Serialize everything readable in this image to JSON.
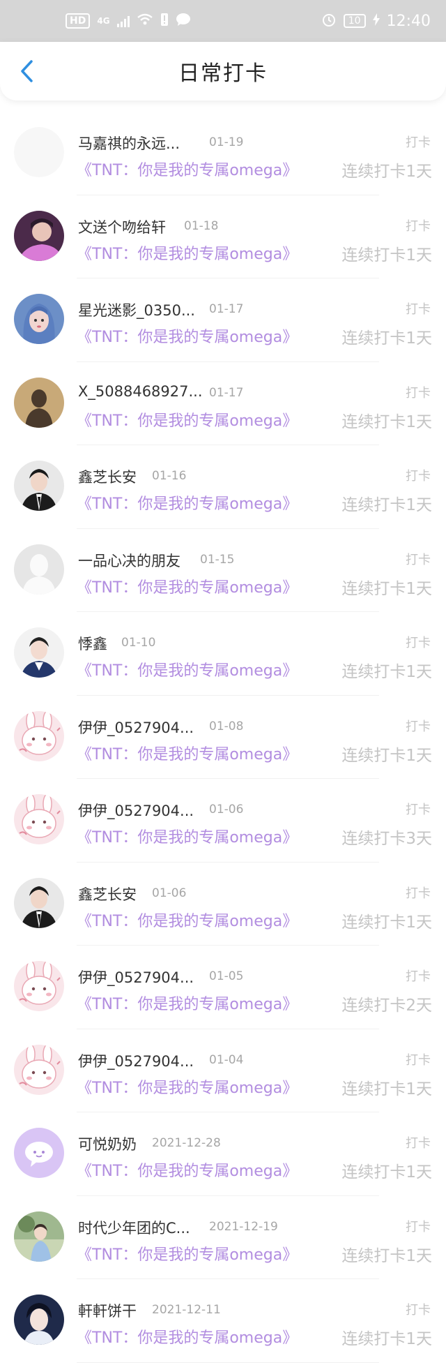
{
  "status_bar": {
    "hd": "HD",
    "network": "4G",
    "battery": "10",
    "time": "12:40"
  },
  "header": {
    "title": "日常打卡",
    "back_icon": "chevron-left-icon"
  },
  "colors": {
    "book_title": "#b28de0",
    "muted": "#c4c4c4",
    "back": "#2f8fe0"
  },
  "items": [
    {
      "name": "马嘉祺的永远...",
      "date": "01-19",
      "type": "打卡",
      "book": "《TNT：你是我的专属omega》",
      "streak": "连续打卡1天",
      "avatar": "blank"
    },
    {
      "name": "文送个吻给轩",
      "date": "01-18",
      "type": "打卡",
      "book": "《TNT：你是我的专属omega》",
      "streak": "连续打卡1天",
      "avatar": "photo-pink"
    },
    {
      "name": "星光迷影_0350...",
      "date": "01-17",
      "type": "打卡",
      "book": "《TNT：你是我的专属omega》",
      "streak": "连续打卡1天",
      "avatar": "photo-blue-hair"
    },
    {
      "name": "X_5088468927...",
      "date": "01-17",
      "type": "打卡",
      "book": "《TNT：你是我的专属omega》",
      "streak": "连续打卡1天",
      "avatar": "silhouette-tan"
    },
    {
      "name": "鑫芝长安",
      "date": "01-16",
      "type": "打卡",
      "book": "《TNT：你是我的专属omega》",
      "streak": "连续打卡1天",
      "avatar": "photo-suit"
    },
    {
      "name": "一品心决的朋友",
      "date": "01-15",
      "type": "打卡",
      "book": "《TNT：你是我的专属omega》",
      "streak": "连续打卡1天",
      "avatar": "default-gray"
    },
    {
      "name": "悸鑫",
      "date": "01-10",
      "type": "打卡",
      "book": "《TNT：你是我的专属omega》",
      "streak": "连续打卡1天",
      "avatar": "photo-uniform"
    },
    {
      "name": "伊伊_0527904...",
      "date": "01-08",
      "type": "打卡",
      "book": "《TNT：你是我的专属omega》",
      "streak": "连续打卡1天",
      "avatar": "bunny"
    },
    {
      "name": "伊伊_0527904...",
      "date": "01-06",
      "type": "打卡",
      "book": "《TNT：你是我的专属omega》",
      "streak": "连续打卡3天",
      "avatar": "bunny"
    },
    {
      "name": "鑫芝长安",
      "date": "01-06",
      "type": "打卡",
      "book": "《TNT：你是我的专属omega》",
      "streak": "连续打卡1天",
      "avatar": "photo-suit"
    },
    {
      "name": "伊伊_0527904...",
      "date": "01-05",
      "type": "打卡",
      "book": "《TNT：你是我的专属omega》",
      "streak": "连续打卡2天",
      "avatar": "bunny"
    },
    {
      "name": "伊伊_0527904...",
      "date": "01-04",
      "type": "打卡",
      "book": "《TNT：你是我的专属omega》",
      "streak": "连续打卡1天",
      "avatar": "bunny"
    },
    {
      "name": "可悦奶奶",
      "date": "2021-12-28",
      "type": "打卡",
      "book": "《TNT：你是我的专属omega》",
      "streak": "连续打卡1天",
      "avatar": "purple-bubble"
    },
    {
      "name": "时代少年团的C...",
      "date": "2021-12-19",
      "type": "打卡",
      "book": "《TNT：你是我的专属omega》",
      "streak": "连续打卡1天",
      "avatar": "photo-outdoor"
    },
    {
      "name": "軒軒饼干",
      "date": "2021-12-11",
      "type": "打卡",
      "book": "《TNT：你是我的专属omega》",
      "streak": "连续打卡1天",
      "avatar": "photo-dark"
    }
  ]
}
